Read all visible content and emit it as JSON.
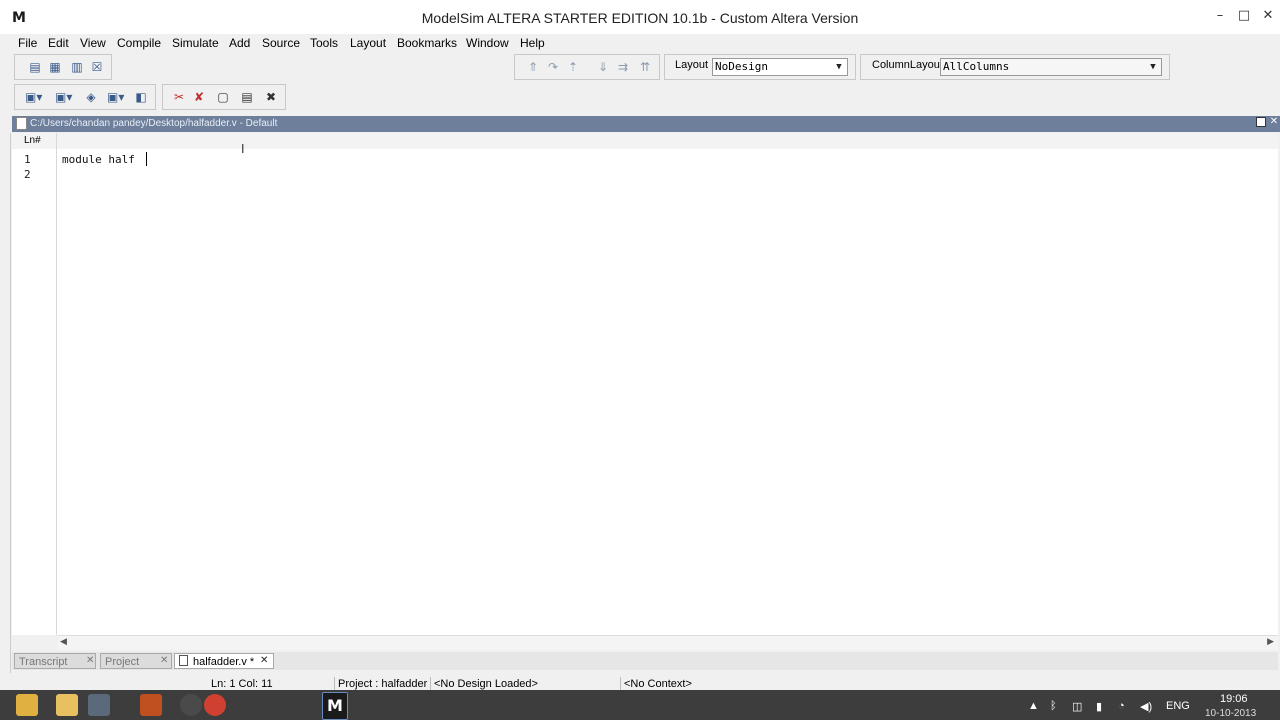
{
  "window": {
    "logo_letter": "M",
    "title": "ModelSim ALTERA STARTER EDITION 10.1b - Custom Altera Version",
    "minimize": "–",
    "maximize": "□",
    "close": "✕"
  },
  "menu": {
    "items": [
      "File",
      "Edit",
      "View",
      "Compile",
      "Simulate",
      "Add",
      "Source",
      "Tools",
      "Layout",
      "Bookmarks",
      "Window",
      "Help"
    ]
  },
  "toolbar": {
    "layout_label": "Layout",
    "layout_value": "NoDesign",
    "column_layout_label": "ColumnLayout",
    "column_layout_value": "AllColumns"
  },
  "panel": {
    "title": "C:/Users/chandan pandey/Desktop/halfadder.v - Default"
  },
  "editor": {
    "ln_header": "Ln#",
    "line_numbers": [
      "1",
      "2"
    ],
    "code_line_1": "module half"
  },
  "tabs": {
    "transcript": "Transcript",
    "project": "Project",
    "file": "halfadder.v *",
    "close_glyph": "✕"
  },
  "status": {
    "position": "Ln:   1  Col: 11",
    "project": "Project : halfadder",
    "design": "<No Design Loaded>",
    "context": "<No Context>"
  },
  "taskbar": {
    "language": "ENG",
    "time": "19:06",
    "date": "10-10-2013"
  }
}
